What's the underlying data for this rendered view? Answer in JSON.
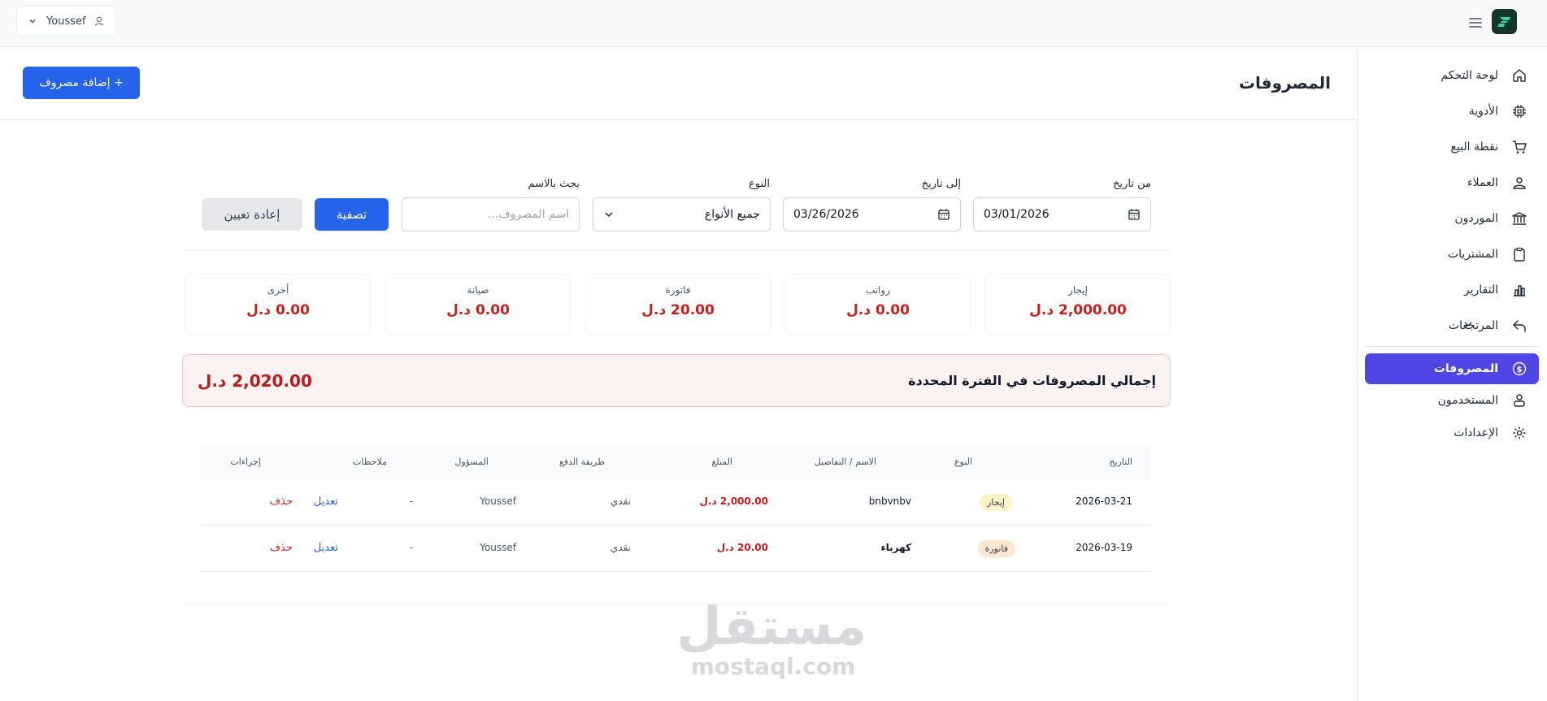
{
  "topbar": {
    "user_name": "Youssef"
  },
  "sidebar": {
    "items": [
      {
        "label": "لوحة التحكم",
        "icon": "home-icon"
      },
      {
        "label": "الأدوية",
        "icon": "chip-icon"
      },
      {
        "label": "نقطة البيع",
        "icon": "cart-icon"
      },
      {
        "label": "العملاء",
        "icon": "users-icon"
      },
      {
        "label": "الموردون",
        "icon": "bank-icon"
      },
      {
        "label": "المشتريات",
        "icon": "clipboard-icon"
      },
      {
        "label": "التقارير",
        "icon": "bar-chart-icon"
      },
      {
        "label": "المرتجعات",
        "icon": "return-icon"
      },
      {
        "label": "المصروفات",
        "icon": "dollar-icon"
      },
      {
        "label": "المستخدمون",
        "icon": "user-group-icon"
      },
      {
        "label": "الإعدادات",
        "icon": "gear-icon"
      }
    ],
    "active_index": 8
  },
  "header": {
    "title": "المصروفات",
    "add_button": "+ إضافة مصروف"
  },
  "filters": {
    "from_label": "من تاريخ",
    "from_value": "03/01/2026",
    "to_label": "إلى تاريخ",
    "to_value": "03/26/2026",
    "type_label": "النوع",
    "type_value": "جميع الأنواع",
    "search_label": "بحث بالاسم",
    "search_placeholder": "اسم المصروف...",
    "filter_button": "تصفية",
    "reset_button": "إعادة تعيين"
  },
  "summary": [
    {
      "label": "إيجار",
      "value": "2,000.00 د.ل"
    },
    {
      "label": "رواتب",
      "value": "0.00 د.ل"
    },
    {
      "label": "فاتورة",
      "value": "20.00 د.ل"
    },
    {
      "label": "صيانة",
      "value": "0.00 د.ل"
    },
    {
      "label": "أخرى",
      "value": "0.00 د.ل"
    }
  ],
  "total": {
    "label": "إجمالي المصروفات في الفترة المحددة",
    "value": "2,020.00 د.ل"
  },
  "table": {
    "columns": [
      "التاريخ",
      "النوع",
      "الاسم / التفاصيل",
      "المبلغ",
      "طريقة الدفع",
      "المسؤول",
      "ملاحظات",
      "إجراءات"
    ],
    "rows": [
      {
        "date": "2026-03-21",
        "type": "إيجار",
        "name": "bnbvnbv",
        "amount": "2,000.00 د.ل",
        "method": "نقدي",
        "owner": "Youssef",
        "notes": "-",
        "edit": "تعديل",
        "delete": "حذف"
      },
      {
        "date": "2026-03-19",
        "type": "فاتورة",
        "name": "كهرباء",
        "amount": "20.00 د.ل",
        "method": "نقدي",
        "owner": "Youssef",
        "notes": "-",
        "edit": "تعديل",
        "delete": "حذف"
      }
    ]
  },
  "watermark": {
    "arabic": "مستقل",
    "latin": "mostaql.com"
  },
  "colors": {
    "primary": "#2563eb",
    "active_nav": "#4f46e5",
    "danger": "#c81e1e",
    "total_bg": "#fdf2f2"
  }
}
